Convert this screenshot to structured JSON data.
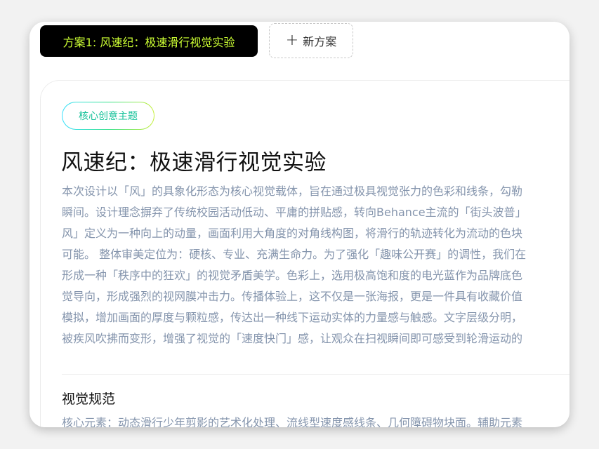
{
  "tabs": {
    "active_label": "方案1: 风速纪：极速滑行视觉实验",
    "new_label": "新方案",
    "new_icon": "plus-icon"
  },
  "card": {
    "badge": "核心创意主题",
    "title": "风速纪：极速滑行视觉实验",
    "description_lines": [
      "本次设计以「风」的具象化形态为核心视觉载体，旨在通过极具视觉张力的色彩和线条，勾勒",
      "瞬间。设计理念摒弃了传统校园活动低动、平庸的拼贴感，转向Behance主流的「街头波普」",
      "风」定义为一种向上的动量，画面利用大角度的对角线构图，将滑行的轨迹转化为流动的色块",
      "可能。 整体审美定位为：硬核、专业、充满生命力。为了强化「趣味公开赛」的调性，我们在",
      "形成一种「秩序中的狂欢」的视觉矛盾美学。色彩上，选用极高饱和度的电光蓝作为品牌底色",
      "觉导向，形成强烈的视网膜冲击力。传播体验上，这不仅是一张海报，更是一件具有收藏价值",
      "模拟，增加画面的厚度与颗粒感，传达出一种线下运动实体的力量感与触感。文字层级分明，",
      "被疾风吹拂而变形，增强了视觉的「速度快门」感，让观众在扫视瞬间即可感受到轮滑运动的"
    ],
    "section_title": "视觉规范",
    "section_text": "核心元素：动态滑行少年剪影的艺术化处理、流线型速度感线条、几何障碍物块面。辅助元素"
  },
  "colors": {
    "active_tab_bg": "#000000",
    "active_tab_text": "#ccff33",
    "badge_text": "#17c29a",
    "body_text": "#8595ad"
  }
}
